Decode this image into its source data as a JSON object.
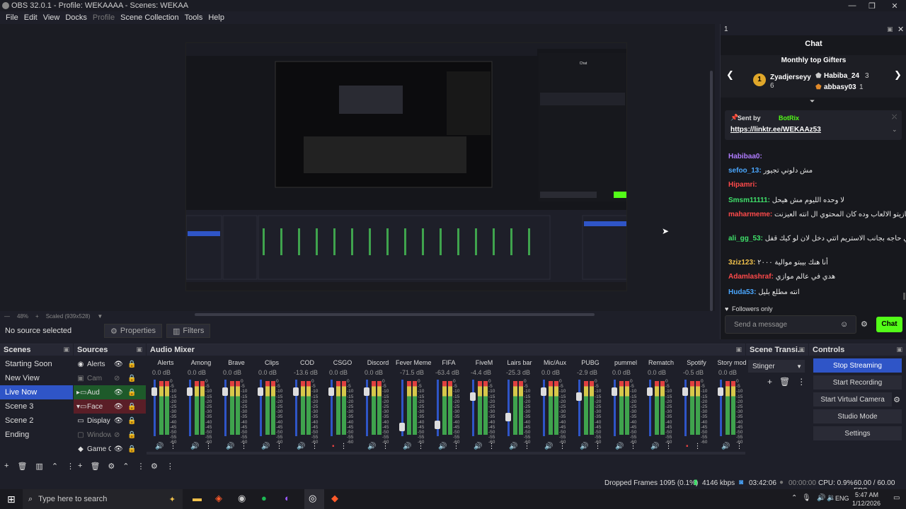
{
  "window": {
    "title": "OBS 32.0.1 - Profile: WEKAAAA - Scenes: WEKAA"
  },
  "menu": [
    "File",
    "Edit",
    "View",
    "Docks",
    "Profile",
    "Scene Collection",
    "Tools",
    "Help"
  ],
  "preview": {
    "zoom": "48%",
    "scaled": "Scaled (939x528)"
  },
  "properties_bar": {
    "no_source": "No source selected",
    "properties": "Properties",
    "filters": "Filters"
  },
  "scenes": {
    "title": "Scenes",
    "items": [
      "Starting Soon",
      "New View",
      "Live Now",
      "Scene 3",
      "Scene 2",
      "Ending"
    ],
    "active": "Live Now"
  },
  "sources": {
    "title": "Sources",
    "items": [
      "Alerts",
      "Cam",
      "Aud",
      "Face",
      "Display",
      "Window",
      "Game C"
    ]
  },
  "mixer": {
    "title": "Audio Mixer",
    "channels": [
      {
        "name": "Alerts",
        "db": "0.0 dB",
        "level": 0.85,
        "muted": false
      },
      {
        "name": "Among",
        "db": "0.0 dB",
        "level": 0.85,
        "muted": false
      },
      {
        "name": "Brave",
        "db": "0.0 dB",
        "level": 0.85,
        "muted": false
      },
      {
        "name": "Clips",
        "db": "0.0 dB",
        "level": 0.85,
        "muted": false
      },
      {
        "name": "COD",
        "db": "-13.6 dB",
        "level": 0.85,
        "muted": false
      },
      {
        "name": "CSGO",
        "db": "0.0 dB",
        "level": 0.85,
        "muted": true
      },
      {
        "name": "Discord",
        "db": "0.0 dB",
        "level": 0.85,
        "muted": false
      },
      {
        "name": "Fever Meme",
        "db": "-71.5 dB",
        "level": 0.15,
        "muted": false
      },
      {
        "name": "FIFA",
        "db": "-63.4 dB",
        "level": 0.2,
        "muted": false
      },
      {
        "name": "FiveM",
        "db": "-4.4 dB",
        "level": 0.75,
        "muted": false
      },
      {
        "name": "Lairs bar",
        "db": "-25.3 dB",
        "level": 0.35,
        "muted": false
      },
      {
        "name": "Mic/Aux",
        "db": "0.0 dB",
        "level": 0.85,
        "muted": false
      },
      {
        "name": "PUBG",
        "db": "-2.9 dB",
        "level": 0.75,
        "muted": false
      },
      {
        "name": "pummel",
        "db": "0.0 dB",
        "level": 0.85,
        "muted": false
      },
      {
        "name": "Rematch",
        "db": "0.0 dB",
        "level": 0.85,
        "muted": false
      },
      {
        "name": "Spotify",
        "db": "-0.5 dB",
        "level": 0.85,
        "muted": true
      },
      {
        "name": "Story mod",
        "db": "0.0 dB",
        "level": 0.85,
        "muted": false
      }
    ],
    "scale": [
      "0",
      "-5",
      "-10",
      "-15",
      "-20",
      "-25",
      "-30",
      "-35",
      "-40",
      "-45",
      "-50",
      "-55",
      "-60"
    ]
  },
  "transitions": {
    "title": "Scene Transi...",
    "value": "Stinger"
  },
  "controls": {
    "title": "Controls",
    "buttons": [
      "Stop Streaming",
      "Start Recording",
      "Start Virtual Camera",
      "Studio Mode",
      "Settings"
    ]
  },
  "status": {
    "dropped": "Dropped Frames 1095 (0.1%)",
    "kbps": "4146 kbps",
    "live_time": "03:42:06",
    "rec_time": "00:00:00",
    "cpu": "CPU: 0.9%",
    "fps": "60.00 / 60.00 FPS"
  },
  "taskbar": {
    "search": "Type here to search",
    "lang": "ENG",
    "time": "5:47 AM",
    "date": "1/12/2026"
  },
  "chat": {
    "dock_title": "1",
    "title": "Chat",
    "gifters_title": "Monthly top Gifters",
    "gifters": [
      {
        "name": "Zyadjerseyy",
        "count": "6",
        "rank": "1"
      },
      {
        "name": "Habiba_24",
        "count": "3"
      },
      {
        "name": "abbasy03",
        "count": "1"
      }
    ],
    "pinned_by": "Sent by",
    "pinned_user": "BotRix",
    "pinned_link": "https://linktr.ee/WEKAAz53",
    "messages": [
      {
        "user": "Habibaa0:",
        "color": "#b07cff",
        "text": ""
      },
      {
        "user": "sefoo_13:",
        "color": "#4aa7ff",
        "text": "مش دلوني تجيور"
      },
      {
        "user": "Hipamri:",
        "color": "#ff4a4a",
        "text": ""
      },
      {
        "user": "Smsm11111:",
        "color": "#3fe06a",
        "text": "لا وحده الليوم مش هيحل"
      },
      {
        "user": "maharmeme:",
        "color": "#ff4a4a",
        "text": "انته فكست كازيتو الالعاب وده كان المحتوي ال انته العيزنت"
      },
      {
        "user": "ali_gg_53:",
        "color": "#3fe06a",
        "text": "يا اتنتي فكر في حاجه بجانب الاستريم اتتي دخل لان لو كيك قفل"
      },
      {
        "user": "3ziz123:",
        "color": "#f0c14b",
        "text": "أنا هنك بيبتو موالية ٢٠٠٠"
      },
      {
        "user": "Adamlashraf:",
        "color": "#ff4a4a",
        "text": "هدي في عالم موازي"
      },
      {
        "user": "Huda53:",
        "color": "#4aa7ff",
        "text": "انته مطلع بليل"
      }
    ],
    "followers": "Followers only",
    "placeholder": "Send a message",
    "send": "Chat"
  },
  "colors": {
    "accent": "#2f55c7",
    "chat_send": "#53fc18"
  }
}
